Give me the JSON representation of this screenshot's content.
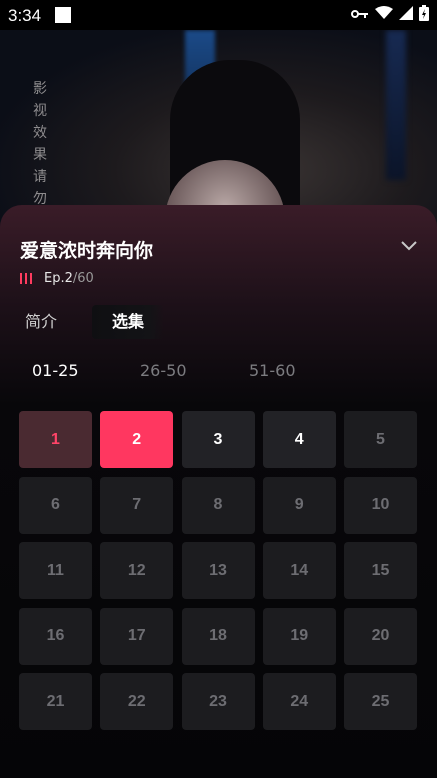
{
  "status_bar": {
    "time": "3:34"
  },
  "video": {
    "watermark": "影视效果 请勿模"
  },
  "panel": {
    "title": "爱意浓时奔向你",
    "current_episode_prefix": "Ep.2",
    "total_episodes": "/60"
  },
  "tabs": [
    {
      "label": "简介"
    },
    {
      "label": "选集"
    }
  ],
  "active_tab": "选集",
  "ranges": [
    {
      "label": "01-25"
    },
    {
      "label": "26-50"
    },
    {
      "label": "51-60"
    }
  ],
  "active_range": "01-25",
  "episodes": [
    {
      "n": "1",
      "state": "watched"
    },
    {
      "n": "2",
      "state": "current"
    },
    {
      "n": "3",
      "state": "available"
    },
    {
      "n": "4",
      "state": "available"
    },
    {
      "n": "5",
      "state": "locked"
    },
    {
      "n": "6",
      "state": "locked"
    },
    {
      "n": "7",
      "state": "locked"
    },
    {
      "n": "8",
      "state": "locked"
    },
    {
      "n": "9",
      "state": "locked"
    },
    {
      "n": "10",
      "state": "locked"
    },
    {
      "n": "11",
      "state": "locked"
    },
    {
      "n": "12",
      "state": "locked"
    },
    {
      "n": "13",
      "state": "locked"
    },
    {
      "n": "14",
      "state": "locked"
    },
    {
      "n": "15",
      "state": "locked"
    },
    {
      "n": "16",
      "state": "locked"
    },
    {
      "n": "17",
      "state": "locked"
    },
    {
      "n": "18",
      "state": "locked"
    },
    {
      "n": "19",
      "state": "locked"
    },
    {
      "n": "20",
      "state": "locked"
    },
    {
      "n": "21",
      "state": "locked"
    },
    {
      "n": "22",
      "state": "locked"
    },
    {
      "n": "23",
      "state": "locked"
    },
    {
      "n": "24",
      "state": "locked"
    },
    {
      "n": "25",
      "state": "locked"
    }
  ],
  "colors": {
    "accent": "#ff3760",
    "watched_bg": "#4a2a31",
    "cell_bg": "#1c1c1f"
  },
  "icons": {
    "collapse": "chevron-down-icon",
    "playing": "equalizer-icon"
  }
}
